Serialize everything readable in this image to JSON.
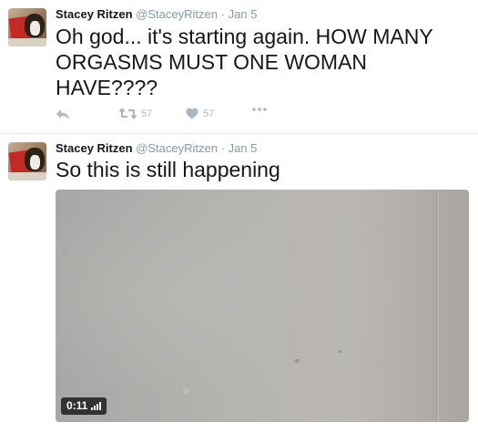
{
  "tweets": [
    {
      "author": "Stacey Ritzen",
      "handle": "@StaceyRitzen",
      "separator": "·",
      "date": "Jan 5",
      "text": "Oh god... it's starting again. HOW MANY ORGASMS MUST ONE WOMAN HAVE????",
      "retweets": "57",
      "likes": "57",
      "icons": [
        "reply-icon",
        "retweet-icon",
        "like-icon",
        "more-icon"
      ]
    },
    {
      "author": "Stacey Ritzen",
      "handle": "@StaceyRitzen",
      "separator": "·",
      "date": "Jan 5",
      "text": "So this is still happening",
      "video_duration": "0:11"
    }
  ],
  "colors": {
    "text": "#14171a",
    "muted": "#8899a6",
    "action_gray": "#aab8c2",
    "divider": "#e1e8ed"
  }
}
